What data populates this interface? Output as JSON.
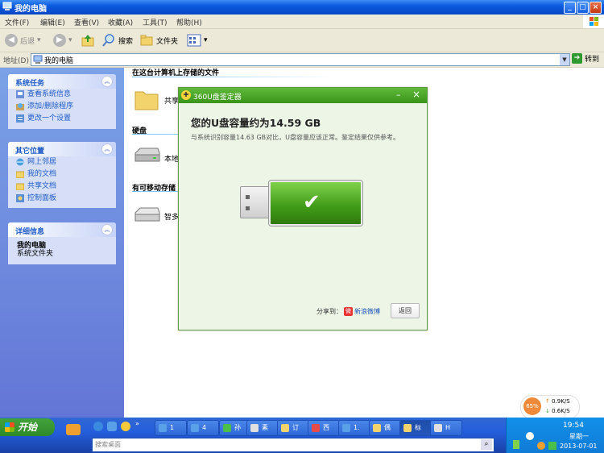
{
  "window": {
    "title": "我的电脑"
  },
  "menu": [
    "文件(F)",
    "编辑(E)",
    "查看(V)",
    "收藏(A)",
    "工具(T)",
    "帮助(H)"
  ],
  "toolbar": {
    "back": "后退",
    "search": "搜索",
    "folders": "文件夹"
  },
  "address": {
    "label": "地址(D)",
    "value": "我的电脑",
    "go": "转到"
  },
  "sidebar": {
    "tasks": {
      "title": "系统任务",
      "items": [
        "查看系统信息",
        "添加/删除程序",
        "更改一个设置"
      ]
    },
    "places": {
      "title": "其它位置",
      "items": [
        "网上邻居",
        "我的文档",
        "共享文档",
        "控制面板"
      ]
    },
    "details": {
      "title": "详细信息",
      "name": "我的电脑",
      "type": "系统文件夹"
    }
  },
  "content": {
    "section_files": "在这台计算机上存储的文件",
    "shared_label": "共享",
    "section_disk": "硬盘",
    "disk_label": "本地",
    "section_removable": "有可移动存储",
    "removable_label": "智多"
  },
  "dialog": {
    "title": "360U盘鉴定器",
    "headline": "您的U盘容量约为14.59 GB",
    "subtext": "与系统识别容量14.63 GB对比，U盘容量应该正常。鉴定结果仅供参考。",
    "share": "分享到：",
    "weibo": "新浪微博",
    "back": "返回"
  },
  "speed": {
    "percent": "65%",
    "up": "0.9K/S",
    "down": "0.6K/S"
  },
  "taskbar": {
    "start": "开始",
    "tasks": [
      "1",
      "4",
      "孙",
      "素",
      "订",
      "西",
      "1.",
      "偶",
      "标",
      "H"
    ],
    "search_placeholder": "搜索桌面",
    "time": "19:54",
    "weekday": "星期一",
    "date": "2013-07-01"
  },
  "colors": {
    "title_blue": "#0a5ade",
    "dialog_green": "#3a9418",
    "sidebar_blue": "#6375d6"
  }
}
